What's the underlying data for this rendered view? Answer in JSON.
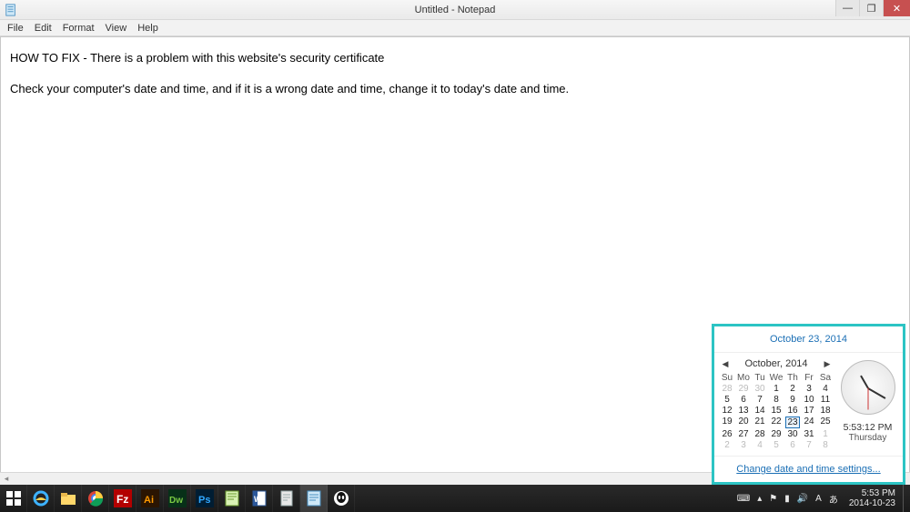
{
  "window": {
    "title": "Untitled - Notepad",
    "min": "—",
    "max": "❐",
    "close": "✕"
  },
  "menu": {
    "file": "File",
    "edit": "Edit",
    "format": "Format",
    "view": "View",
    "help": "Help"
  },
  "document": {
    "line1": "HOW TO FIX - There is a problem with this website's security certificate",
    "line2": "Check your computer's date and time, and if it is a wrong date and time, change it to today's date and time."
  },
  "datetime": {
    "header": "October 23, 2014",
    "month_label": "October, 2014",
    "dow": [
      "Su",
      "Mo",
      "Tu",
      "We",
      "Th",
      "Fr",
      "Sa"
    ],
    "grid": [
      {
        "n": "28",
        "m": true
      },
      {
        "n": "29",
        "m": true
      },
      {
        "n": "30",
        "m": true
      },
      {
        "n": "1"
      },
      {
        "n": "2"
      },
      {
        "n": "3"
      },
      {
        "n": "4"
      },
      {
        "n": "5"
      },
      {
        "n": "6"
      },
      {
        "n": "7"
      },
      {
        "n": "8"
      },
      {
        "n": "9"
      },
      {
        "n": "10"
      },
      {
        "n": "11"
      },
      {
        "n": "12"
      },
      {
        "n": "13"
      },
      {
        "n": "14"
      },
      {
        "n": "15"
      },
      {
        "n": "16"
      },
      {
        "n": "17"
      },
      {
        "n": "18"
      },
      {
        "n": "19"
      },
      {
        "n": "20"
      },
      {
        "n": "21"
      },
      {
        "n": "22"
      },
      {
        "n": "23",
        "t": true
      },
      {
        "n": "24"
      },
      {
        "n": "25"
      },
      {
        "n": "26"
      },
      {
        "n": "27"
      },
      {
        "n": "28"
      },
      {
        "n": "29"
      },
      {
        "n": "30"
      },
      {
        "n": "31"
      },
      {
        "n": "1",
        "m": true
      },
      {
        "n": "2",
        "m": true
      },
      {
        "n": "3",
        "m": true
      },
      {
        "n": "4",
        "m": true
      },
      {
        "n": "5",
        "m": true
      },
      {
        "n": "6",
        "m": true
      },
      {
        "n": "7",
        "m": true
      },
      {
        "n": "8",
        "m": true
      }
    ],
    "time": "5:53:12 PM",
    "day": "Thursday",
    "settings_link": "Change date and time settings..."
  },
  "taskbar": {
    "items": [
      {
        "name": "start-button",
        "bg": "#101010"
      },
      {
        "name": "ie-icon",
        "bg": "#1a1a1a"
      },
      {
        "name": "file-explorer-icon",
        "bg": "#1a1a1a"
      },
      {
        "name": "chrome-icon",
        "bg": "#1a1a1a"
      },
      {
        "name": "filezilla-icon",
        "bg": "#1a1a1a"
      },
      {
        "name": "illustrator-icon",
        "bg": "#1a1a1a"
      },
      {
        "name": "dreamweaver-icon",
        "bg": "#1a1a1a"
      },
      {
        "name": "photoshop-icon",
        "bg": "#1a1a1a"
      },
      {
        "name": "notepadpp-icon",
        "bg": "#1a1a1a"
      },
      {
        "name": "word-icon",
        "bg": "#1a1a1a"
      },
      {
        "name": "document-icon",
        "bg": "#1a1a1a"
      },
      {
        "name": "notepad-task-icon",
        "bg": "#3a3a3a",
        "active": true
      },
      {
        "name": "alien-icon",
        "bg": "#1a1a1a"
      }
    ],
    "tray": {
      "keyboard": "⌨",
      "up": "▴",
      "flag": "⚑",
      "network": "▮",
      "volume": "🔊",
      "lang1": "A",
      "lang2": "あ",
      "time": "5:53 PM",
      "date": "2014-10-23"
    }
  }
}
